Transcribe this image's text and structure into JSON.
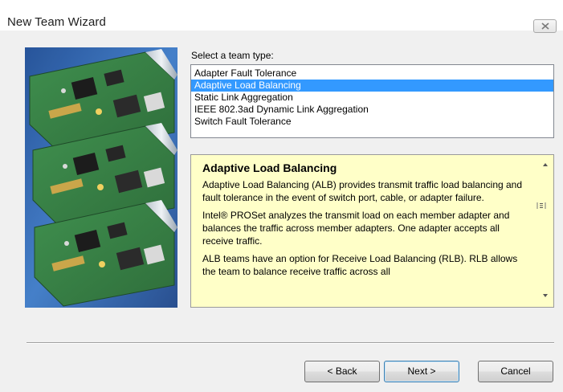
{
  "window": {
    "title": "New Team Wizard"
  },
  "team_type": {
    "label": "Select a team type:",
    "options": [
      "Adapter Fault Tolerance",
      "Adaptive Load Balancing",
      "Static Link Aggregation",
      "IEEE 802.3ad Dynamic Link Aggregation",
      "Switch Fault Tolerance"
    ],
    "selected": "Adaptive Load Balancing"
  },
  "description": {
    "title": "Adaptive Load Balancing",
    "paragraphs": [
      "Adaptive Load Balancing (ALB) provides transmit traffic load balancing and fault tolerance in the event of switch port, cable, or adapter failure.",
      "Intel® PROSet analyzes the transmit load on each member adapter and balances the traffic across member adapters. One adapter accepts all receive traffic.",
      "ALB teams have an option for Receive Load Balancing (RLB). RLB allows the team to balance receive traffic across all"
    ]
  },
  "buttons": {
    "back": "< Back",
    "next": "Next >",
    "cancel": "Cancel"
  },
  "colors": {
    "selection": "#3399ff",
    "description_bg": "#ffffc8",
    "window_bg": "#f0f0f0"
  }
}
